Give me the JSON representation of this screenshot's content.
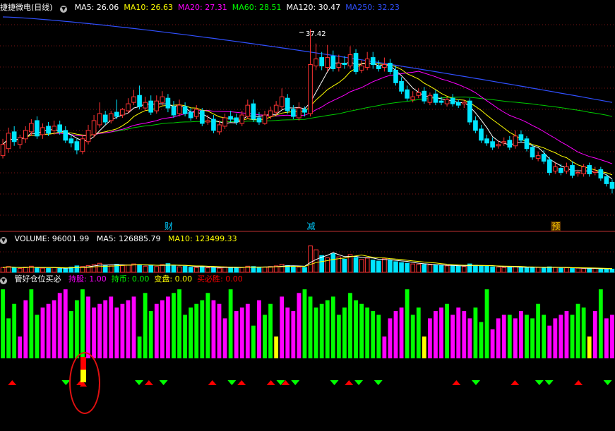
{
  "header": {
    "title": "捷捷微电(日线)",
    "ma": [
      {
        "label": "MA5: 26.06",
        "color": "#ffffff"
      },
      {
        "label": "MA10: 26.63",
        "color": "#ffff00"
      },
      {
        "label": "MA20: 27.31",
        "color": "#ff00ff"
      },
      {
        "label": "MA60: 28.51",
        "color": "#00ff00"
      },
      {
        "label": "MA120: 30.47",
        "color": "#ffffff"
      },
      {
        "label": "MA250: 32.23",
        "color": "#3050ff"
      }
    ]
  },
  "volume_header": {
    "label": "VOLUME: 96001.99",
    "ma5": "MA5: 126885.79",
    "ma10": "MA10: 123499.33"
  },
  "indicator_header": {
    "name": "管好仓位买必",
    "values": [
      {
        "label": "持股: 1.00",
        "color": "#ff00ff"
      },
      {
        "label": "持币: 0.00",
        "color": "#00ff00"
      },
      {
        "label": "变盘: 0.00",
        "color": "#ffff00"
      },
      {
        "label": "买必胜: 0.00",
        "color": "#ff0000"
      }
    ]
  },
  "annotations": {
    "price_high": "37.42",
    "markers": [
      {
        "text": "财",
        "bar": 29,
        "color": "#00ccff"
      },
      {
        "text": "减",
        "bar": 54,
        "color": "#00ccff"
      },
      {
        "text": "预",
        "bar": 97,
        "color": "#ffcc00"
      }
    ]
  },
  "colors": {
    "up": "#ff3333",
    "down": "#00e5ff",
    "hold": "#ff00ff",
    "cash": "#00ff00",
    "change": "#ffff00",
    "buy_signal": "#ff0000",
    "sell_signal": "#00ff00"
  },
  "chart_data": {
    "type": "candlestick",
    "bars": 108,
    "price_range": [
      23.5,
      38.6
    ],
    "ma_levels_last": {
      "MA5": 26.06,
      "MA10": 26.63,
      "MA20": 27.31,
      "MA60": 28.51,
      "MA120": 30.47,
      "MA250": 32.23
    },
    "close": [
      29.2,
      30.0,
      29.4,
      29.7,
      30.2,
      30.7,
      29.8,
      30.4,
      30.0,
      30.5,
      30.1,
      29.5,
      29.3,
      28.8,
      29.6,
      30.2,
      30.9,
      31.4,
      30.8,
      31.4,
      31.2,
      31.7,
      32.1,
      32.6,
      31.9,
      32.2,
      31.5,
      32.3,
      32.6,
      31.8,
      31.3,
      32.0,
      31.4,
      31.1,
      31.7,
      30.7,
      30.9,
      30.2,
      30.6,
      31.1,
      31.0,
      30.8,
      31.3,
      32.0,
      31.0,
      30.8,
      31.3,
      31.6,
      32.0,
      32.6,
      31.6,
      31.2,
      31.8,
      31.5,
      34.9,
      35.3,
      34.8,
      35.4,
      34.6,
      35.0,
      34.9,
      35.6,
      34.4,
      34.8,
      35.3,
      34.9,
      34.6,
      34.9,
      34.4,
      33.6,
      33.0,
      32.5,
      32.6,
      32.9,
      32.3,
      32.7,
      32.2,
      32.2,
      32.4,
      32.1,
      32.0,
      32.2,
      30.8,
      30.2,
      29.5,
      29.3,
      29.0,
      29.2,
      29.4,
      29.0,
      29.8,
      29.5,
      28.9,
      28.3,
      28.4,
      28.0,
      27.2,
      27.6,
      27.2,
      27.6,
      27.0,
      27.2,
      27.6,
      27.1,
      27.3,
      26.8,
      26.4,
      26.06
    ],
    "open": [
      28.4,
      28.9,
      30.1,
      29.2,
      29.6,
      30.1,
      30.9,
      29.9,
      30.5,
      30.2,
      30.6,
      30.2,
      29.6,
      29.4,
      28.7,
      29.4,
      29.9,
      30.6,
      31.3,
      30.9,
      31.5,
      31.3,
      31.6,
      32.2,
      32.7,
      31.8,
      32.3,
      31.6,
      32.2,
      32.5,
      31.9,
      31.4,
      31.9,
      31.5,
      31.2,
      31.6,
      30.8,
      31.0,
      30.1,
      30.5,
      31.2,
      31.1,
      30.7,
      31.2,
      32.1,
      31.1,
      30.7,
      31.2,
      31.5,
      31.9,
      32.5,
      31.7,
      31.1,
      31.7,
      31.4,
      34.8,
      35.4,
      34.7,
      35.5,
      34.7,
      35.0,
      34.8,
      35.7,
      34.5,
      34.7,
      35.4,
      34.8,
      34.7,
      35.0,
      34.5,
      33.7,
      33.1,
      32.4,
      32.7,
      33.0,
      32.2,
      32.8,
      32.3,
      32.1,
      32.5,
      32.2,
      32.1,
      32.3,
      30.9,
      30.3,
      29.6,
      29.4,
      29.1,
      29.3,
      29.5,
      29.1,
      29.9,
      29.6,
      29.0,
      28.2,
      28.5,
      28.1,
      27.3,
      27.5,
      27.3,
      27.7,
      27.1,
      27.1,
      27.7,
      27.2,
      27.4,
      26.9,
      26.5
    ],
    "high": [
      29.6,
      30.4,
      30.5,
      29.9,
      30.5,
      31.0,
      31.2,
      30.7,
      30.8,
      30.9,
      30.9,
      30.5,
      29.9,
      29.6,
      29.9,
      30.6,
      31.3,
      32.2,
      31.6,
      31.6,
      32.4,
      31.8,
      32.5,
      33.1,
      33.4,
      32.6,
      32.7,
      32.7,
      33.0,
      32.8,
      32.3,
      32.4,
      32.2,
      31.8,
      32.0,
      31.8,
      31.3,
      31.3,
      30.9,
      31.4,
      31.6,
      31.4,
      31.6,
      32.4,
      32.4,
      31.5,
      31.6,
      31.9,
      32.3,
      33.2,
      32.8,
      32.0,
      32.2,
      31.9,
      37.42,
      36.4,
      35.8,
      36.3,
      35.9,
      35.6,
      35.5,
      36.2,
      36.0,
      35.2,
      35.8,
      35.8,
      35.2,
      35.4,
      35.3,
      34.8,
      34.0,
      33.4,
      33.0,
      33.2,
      33.3,
      32.9,
      33.1,
      32.6,
      32.6,
      32.8,
      32.4,
      32.4,
      32.5,
      31.2,
      30.6,
      29.9,
      29.7,
      29.5,
      29.7,
      29.8,
      30.2,
      30.2,
      29.8,
      29.2,
      28.7,
      28.8,
      28.3,
      27.9,
      27.8,
      27.9,
      28.0,
      27.4,
      27.8,
      27.9,
      27.6,
      27.6,
      27.1,
      26.7
    ],
    "low": [
      28.2,
      28.6,
      29.1,
      28.9,
      29.3,
      29.8,
      29.6,
      29.6,
      29.8,
      29.9,
      29.9,
      29.3,
      29.0,
      28.5,
      28.5,
      29.2,
      29.7,
      30.4,
      30.6,
      30.7,
      31.0,
      31.1,
      31.4,
      32.0,
      31.7,
      31.6,
      31.3,
      31.4,
      32.0,
      31.5,
      31.1,
      31.2,
      31.2,
      30.9,
      31.0,
      30.5,
      30.6,
      30.0,
      29.9,
      30.3,
      30.8,
      30.6,
      30.5,
      31.0,
      30.8,
      30.6,
      30.6,
      31.0,
      31.3,
      31.7,
      31.4,
      31.0,
      30.9,
      31.2,
      31.2,
      34.5,
      34.5,
      34.4,
      34.4,
      34.4,
      34.6,
      34.6,
      34.2,
      34.3,
      34.5,
      34.6,
      34.4,
      34.4,
      34.2,
      33.4,
      32.8,
      32.3,
      32.2,
      32.5,
      32.1,
      32.0,
      32.0,
      32.0,
      31.9,
      31.9,
      31.8,
      31.8,
      30.6,
      30.0,
      29.3,
      29.1,
      28.8,
      28.9,
      29.1,
      28.8,
      28.9,
      29.3,
      28.7,
      28.1,
      28.0,
      27.8,
      27.0,
      27.1,
      27.0,
      27.1,
      26.8,
      26.9,
      26.9,
      26.9,
      27.0,
      26.6,
      26.2,
      25.7
    ],
    "volume": [
      15,
      18,
      14,
      12,
      16,
      19,
      14,
      13,
      12,
      15,
      14,
      11,
      16,
      20,
      18,
      21,
      24,
      28,
      22,
      20,
      25,
      21,
      23,
      26,
      24,
      19,
      22,
      18,
      24,
      27,
      21,
      17,
      19,
      16,
      15,
      18,
      14,
      15,
      13,
      17,
      16,
      14,
      15,
      19,
      18,
      15,
      16,
      18,
      20,
      25,
      21,
      17,
      16,
      15,
      82,
      70,
      52,
      45,
      58,
      48,
      41,
      55,
      46,
      40,
      44,
      38,
      35,
      42,
      37,
      33,
      30,
      28,
      26,
      25,
      24,
      23,
      22,
      21,
      20,
      21,
      19,
      18,
      26,
      22,
      20,
      19,
      17,
      16,
      15,
      16,
      18,
      15,
      14,
      16,
      15,
      14,
      17,
      15,
      13,
      14,
      12,
      13,
      12,
      11,
      12,
      10,
      11,
      10
    ],
    "volume_range": [
      0,
      90
    ],
    "position": [
      "D",
      "D",
      "D",
      "H",
      "H",
      "D",
      "D",
      "H",
      "H",
      "H",
      "H",
      "H",
      "D",
      "D",
      "D",
      "H",
      "H",
      "H",
      "H",
      "H",
      "H",
      "H",
      "H",
      "H",
      "D",
      "D",
      "D",
      "H",
      "H",
      "H",
      "D",
      "D",
      "D",
      "D",
      "D",
      "D",
      "D",
      "H",
      "H",
      "H",
      "D",
      "H",
      "H",
      "H",
      "D",
      "H",
      "D",
      "D",
      "C",
      "H",
      "H",
      "H",
      "H",
      "D",
      "D",
      "D",
      "D",
      "D",
      "D",
      "D",
      "D",
      "D",
      "D",
      "D",
      "D",
      "D",
      "D",
      "H",
      "H",
      "H",
      "H",
      "D",
      "D",
      "D",
      "C",
      "H",
      "H",
      "H",
      "D",
      "H",
      "H",
      "H",
      "H",
      "D",
      "D",
      "D",
      "H",
      "H",
      "H",
      "D",
      "H",
      "H",
      "D",
      "D",
      "D",
      "D",
      "H",
      "H",
      "H",
      "H",
      "D",
      "D",
      "D",
      "C",
      "H",
      "D",
      "H",
      "H"
    ],
    "position_height": [
      0.95,
      0.55,
      0.75,
      0.3,
      0.8,
      0.95,
      0.6,
      0.7,
      0.75,
      0.8,
      0.9,
      0.95,
      0.65,
      0.8,
      0.95,
      0.85,
      0.7,
      0.75,
      0.8,
      0.85,
      0.7,
      0.75,
      0.8,
      0.85,
      0.3,
      0.9,
      0.65,
      0.75,
      0.8,
      0.85,
      0.9,
      0.95,
      0.6,
      0.7,
      0.75,
      0.8,
      0.9,
      0.8,
      0.75,
      0.55,
      0.95,
      0.65,
      0.7,
      0.75,
      0.45,
      0.8,
      0.6,
      0.75,
      0.3,
      0.85,
      0.7,
      0.65,
      0.9,
      0.95,
      0.85,
      0.7,
      0.75,
      0.8,
      0.85,
      0.6,
      0.7,
      0.9,
      0.8,
      0.75,
      0.7,
      0.65,
      0.6,
      0.3,
      0.55,
      0.65,
      0.7,
      0.95,
      0.6,
      0.7,
      0.3,
      0.55,
      0.65,
      0.7,
      0.75,
      0.6,
      0.7,
      0.65,
      0.55,
      0.7,
      0.5,
      0.95,
      0.4,
      0.55,
      0.6,
      0.6,
      0.55,
      0.65,
      0.6,
      0.55,
      0.75,
      0.6,
      0.45,
      0.55,
      0.6,
      0.65,
      0.6,
      0.75,
      0.7,
      0.3,
      0.65,
      0.95,
      0.55,
      0.6
    ],
    "signals": [
      {
        "bar": 2,
        "type": "buy"
      },
      {
        "bar": 13,
        "type": "sell"
      },
      {
        "bar": 16,
        "type": "buy"
      },
      {
        "bar": 28,
        "type": "sell"
      },
      {
        "bar": 30,
        "type": "buy"
      },
      {
        "bar": 33,
        "type": "sell"
      },
      {
        "bar": 43,
        "type": "buy"
      },
      {
        "bar": 47,
        "type": "sell"
      },
      {
        "bar": 49,
        "type": "buy"
      },
      {
        "bar": 55,
        "type": "buy"
      },
      {
        "bar": 57,
        "type": "sell"
      },
      {
        "bar": 58,
        "type": "buy"
      },
      {
        "bar": 60,
        "type": "sell"
      },
      {
        "bar": 68,
        "type": "sell"
      },
      {
        "bar": 71,
        "type": "buy"
      },
      {
        "bar": 73,
        "type": "sell"
      },
      {
        "bar": 77,
        "type": "sell"
      },
      {
        "bar": 93,
        "type": "buy"
      },
      {
        "bar": 97,
        "type": "sell"
      },
      {
        "bar": 105,
        "type": "buy"
      },
      {
        "bar": 110,
        "type": "sell"
      },
      {
        "bar": 112,
        "type": "sell"
      },
      {
        "bar": 118,
        "type": "buy"
      },
      {
        "bar": 124,
        "type": "sell"
      }
    ],
    "highlight_bar": 17
  }
}
